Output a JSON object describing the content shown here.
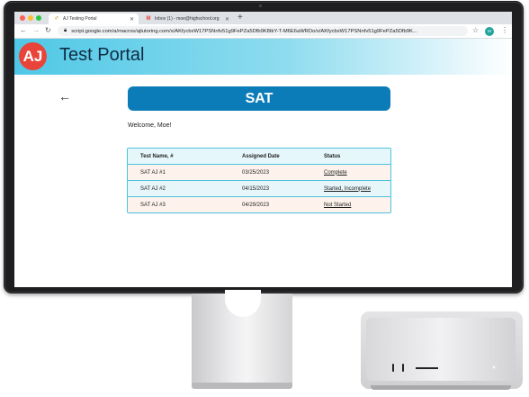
{
  "browser": {
    "tabs": [
      {
        "title": "AJ Testing Portal",
        "active": true
      },
      {
        "title": "Inbox (1) - moe@highschool.org",
        "active": false
      }
    ],
    "url": "script.google.com/a/macros/ajtutoring.com/s/AKfycbxW17PSNnfv51g9FePZa5Dfb9K8tkY-T-M6E6aWRDo/s/AKfycbxW17PSNnfv51g9FePZa5Dfb9K...",
    "profile_initials": "M"
  },
  "app": {
    "logo_text": "AJ",
    "title": "Test Portal",
    "banner": "SAT",
    "welcome": "Welcome, Moe!",
    "table": {
      "headers": [
        "Test Name, #",
        "Assigned Date",
        "Status"
      ],
      "rows": [
        {
          "name": "SAT AJ #1",
          "date": "03/25/2023",
          "status": "Complete"
        },
        {
          "name": "SAT AJ #2",
          "date": "04/15/2023",
          "status": "Started, Incomplete"
        },
        {
          "name": "SAT AJ #3",
          "date": "04/29/2023",
          "status": "Not Started"
        }
      ]
    }
  },
  "icons": [
    "back-arrow-icon",
    "reload-icon",
    "lock-icon",
    "star-icon",
    "menu-icon"
  ],
  "colors": {
    "banner": "#0c7cb8",
    "logo": "#e8443a",
    "table_border": "#4cc2dd",
    "row_odd": "#fdf3ec",
    "row_even": "#e7f6fb"
  }
}
